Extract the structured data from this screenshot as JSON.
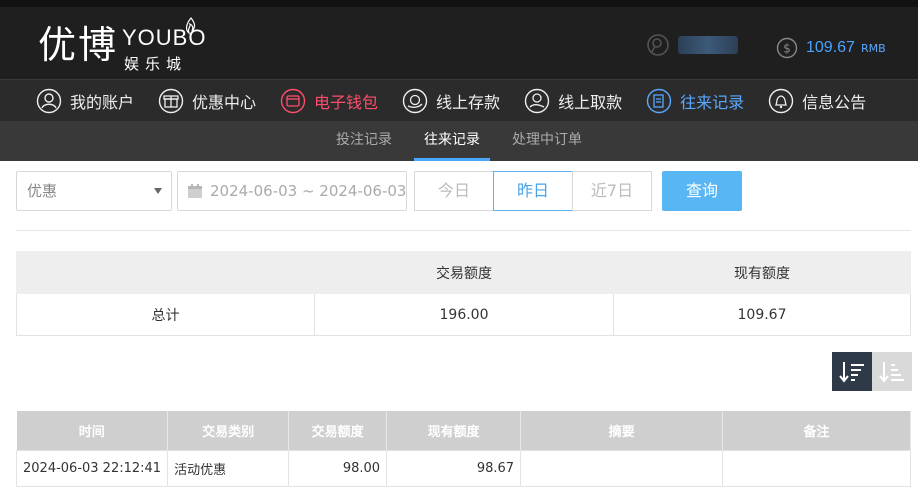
{
  "brand": {
    "name_cn": "优博",
    "name_en": "YOUBO",
    "sub_cn": "娱乐城"
  },
  "account": {
    "balance": "109.67",
    "currency": "RMB"
  },
  "nav": {
    "items": [
      {
        "label": "我的账户",
        "icon": "user-icon"
      },
      {
        "label": "优惠中心",
        "icon": "gift-icon"
      },
      {
        "label": "电子钱包",
        "icon": "wallet-icon"
      },
      {
        "label": "线上存款",
        "icon": "deposit-icon"
      },
      {
        "label": "线上取款",
        "icon": "withdraw-icon"
      },
      {
        "label": "往来记录",
        "icon": "records-icon"
      },
      {
        "label": "信息公告",
        "icon": "bell-icon"
      }
    ]
  },
  "subnav": {
    "items": [
      {
        "label": "投注记录"
      },
      {
        "label": "往来记录"
      },
      {
        "label": "处理中订单"
      }
    ]
  },
  "filters": {
    "type_value": "优惠",
    "date_range": "2024-06-03 ~ 2024-06-03",
    "quick": [
      "今日",
      "昨日",
      "近7日"
    ],
    "query_label": "查询"
  },
  "summary": {
    "col_trans": "交易额度",
    "col_current": "现有额度",
    "row_label": "总计",
    "trans_total": "196.00",
    "current_total": "109.67"
  },
  "records": {
    "headers": [
      "时间",
      "交易类别",
      "交易额度",
      "现有额度",
      "摘要",
      "备注"
    ],
    "rows": [
      [
        "2024-06-03 22:12:41",
        "活动优惠",
        "98.00",
        "98.67",
        "",
        ""
      ]
    ]
  },
  "colors": {
    "accent_blue": "#58b6f4",
    "wallet_red": "#ff4d6d",
    "active_nav_blue": "#59a8ff"
  }
}
